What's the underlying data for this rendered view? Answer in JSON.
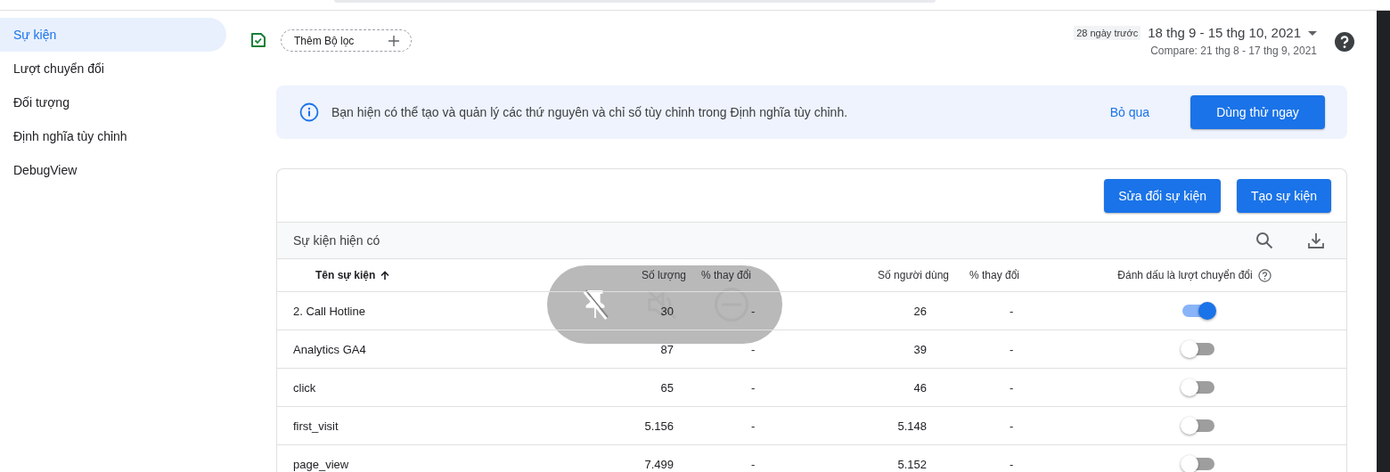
{
  "sidebar": {
    "items": [
      {
        "label": "Sự kiện",
        "selected": true
      },
      {
        "label": "Lượt chuyển đổi",
        "selected": false
      },
      {
        "label": "Đối tượng",
        "selected": false
      },
      {
        "label": "Định nghĩa tùy chỉnh",
        "selected": false
      },
      {
        "label": "DebugView",
        "selected": false
      }
    ]
  },
  "toolbar": {
    "filter_chip": "Thêm Bộ lọc",
    "date_preset": "28 ngày trước",
    "date_range": "18 thg 9 - 15 thg 10, 2021",
    "compare": "Compare: 21 thg 8 - 17 thg 9, 2021"
  },
  "banner": {
    "text": "Bạn hiện có thể tạo và quản lý các thứ nguyên và chỉ số tùy chỉnh trong Định nghĩa tùy chỉnh.",
    "dismiss": "Bỏ qua",
    "action": "Dùng thử ngay"
  },
  "events_card": {
    "buttons": [
      "Sửa đổi sự kiện",
      "Tạo sự kiện"
    ],
    "title": "Sự kiện hiện có",
    "columns": [
      {
        "label": "Tên sự kiện",
        "sort_ascending": true
      },
      {
        "label": "Số lượng"
      },
      {
        "label": "% thay đổi"
      },
      {
        "label": "Số người dùng"
      },
      {
        "label": "% thay đổi"
      },
      {
        "label": "Đánh dấu là lượt chuyển đổi",
        "help": true
      }
    ],
    "rows": [
      {
        "name": "2. Call Hotline",
        "count": "30",
        "count_change": "-",
        "users": "26",
        "users_change": "-",
        "conversion": true
      },
      {
        "name": "Analytics GA4",
        "count": "87",
        "count_change": "-",
        "users": "39",
        "users_change": "-",
        "conversion": false
      },
      {
        "name": "click",
        "count": "65",
        "count_change": "-",
        "users": "46",
        "users_change": "-",
        "conversion": false
      },
      {
        "name": "first_visit",
        "count": "5.156",
        "count_change": "-",
        "users": "5.148",
        "users_change": "-",
        "conversion": false
      },
      {
        "name": "page_view",
        "count": "7.499",
        "count_change": "-",
        "users": "5.152",
        "users_change": "-",
        "conversion": false
      }
    ]
  }
}
